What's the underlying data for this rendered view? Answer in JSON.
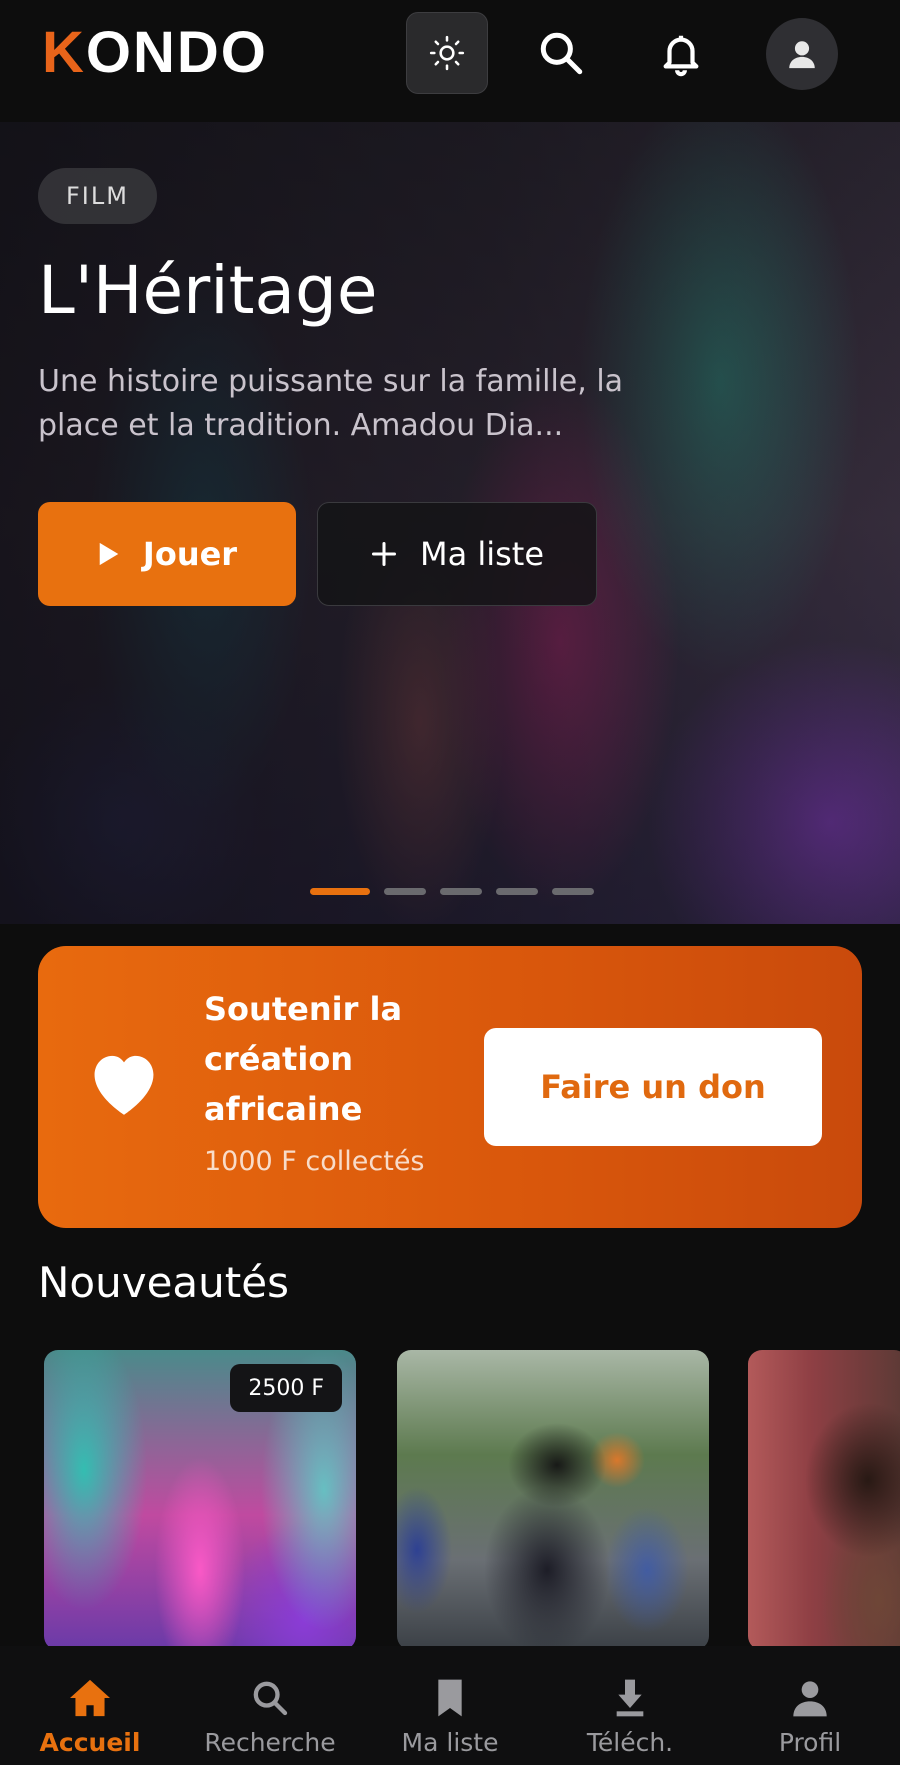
{
  "header": {
    "logo_text": "KONDO",
    "icons": [
      "sun-icon",
      "search-icon",
      "bell-icon",
      "user-icon"
    ]
  },
  "hero": {
    "badge": "FILM",
    "title": "L'Héritage",
    "description": "Une histoire puissante sur la famille, la place et la tradition. Amadou Dia...",
    "play_label": "Jouer",
    "list_label": "Ma liste",
    "carousel": {
      "count": 5,
      "active_index": 0
    }
  },
  "donation": {
    "title": "Soutenir la création africaine",
    "collected": "1000 F collectés",
    "button_label": "Faire un don"
  },
  "new_releases": {
    "title": "Nouveautés",
    "cards": [
      {
        "price": "2500 F"
      },
      {
        "price": ""
      },
      {
        "price": ""
      }
    ]
  },
  "bottom_nav": {
    "items": [
      {
        "label": "Accueil",
        "icon": "home-icon",
        "active": true
      },
      {
        "label": "Recherche",
        "icon": "search-icon",
        "active": false
      },
      {
        "label": "Ma liste",
        "icon": "bookmark-icon",
        "active": false
      },
      {
        "label": "Téléch.",
        "icon": "download-icon",
        "active": false
      },
      {
        "label": "Profil",
        "icon": "user-icon",
        "active": false
      }
    ]
  },
  "colors": {
    "accent": "#e8710f",
    "background": "#0d0d0d"
  }
}
